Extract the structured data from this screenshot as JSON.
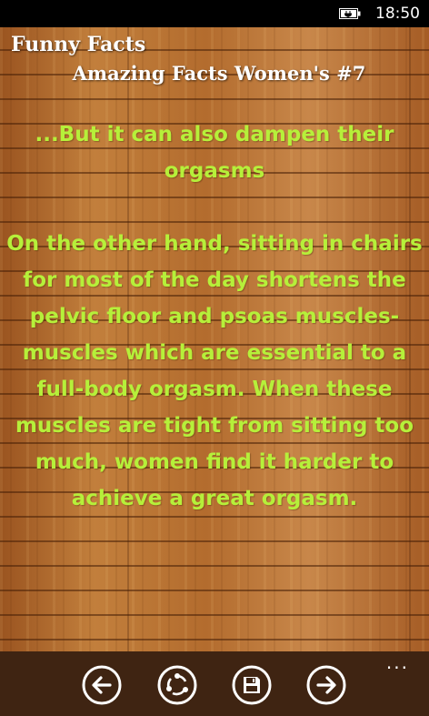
{
  "status_bar": {
    "time": "18:50",
    "battery_icon": "battery-charging-icon"
  },
  "header": {
    "app_title": "Funny Facts",
    "fact_title": "Amazing Facts Women's #7"
  },
  "fact": {
    "lead": "...But it can also dampen their orgasms",
    "body": "On the other hand, sitting in chairs for most of the day shortens the pelvic floor and psoas muscles-muscles which are essential to a full-body orgasm. When these muscles are tight from sitting too much, women find it harder to achieve a great orgasm."
  },
  "app_bar": {
    "more_label": "...",
    "buttons": [
      {
        "name": "previous-button",
        "icon": "arrow-left-icon"
      },
      {
        "name": "share-button",
        "icon": "share-icon"
      },
      {
        "name": "save-button",
        "icon": "save-icon"
      },
      {
        "name": "next-button",
        "icon": "arrow-right-icon"
      }
    ]
  },
  "colors": {
    "body_text": "#b6f03a",
    "title_text": "#ffffff",
    "app_bar_bg": "#3f2412",
    "status_bar_bg": "#000000"
  }
}
